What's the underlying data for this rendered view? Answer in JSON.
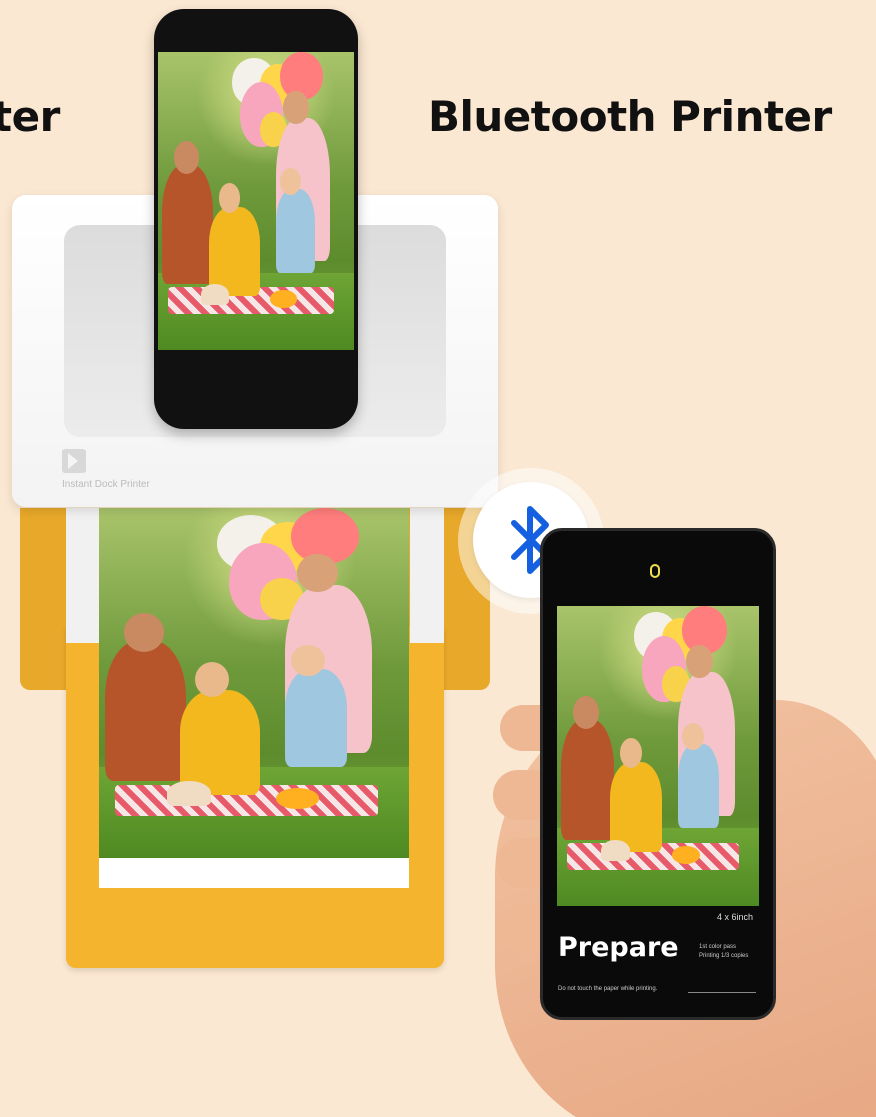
{
  "headings": {
    "left": "ter",
    "right": "Bluetooth Printer"
  },
  "printer": {
    "label": "Instant Dock Printer",
    "body_color": "#ffffff",
    "tray_color": "#f5b42e"
  },
  "bluetooth": {
    "icon": "bluetooth-icon",
    "color": "#1560e0"
  },
  "hand_phone": {
    "size_label": "4 x 6inch",
    "title": "Prepare",
    "status_line1": "1st color pass",
    "status_line2": "Printing 1/3 copies",
    "warning": "Do not touch the paper while printing."
  },
  "background_color": "#fbe8d2"
}
